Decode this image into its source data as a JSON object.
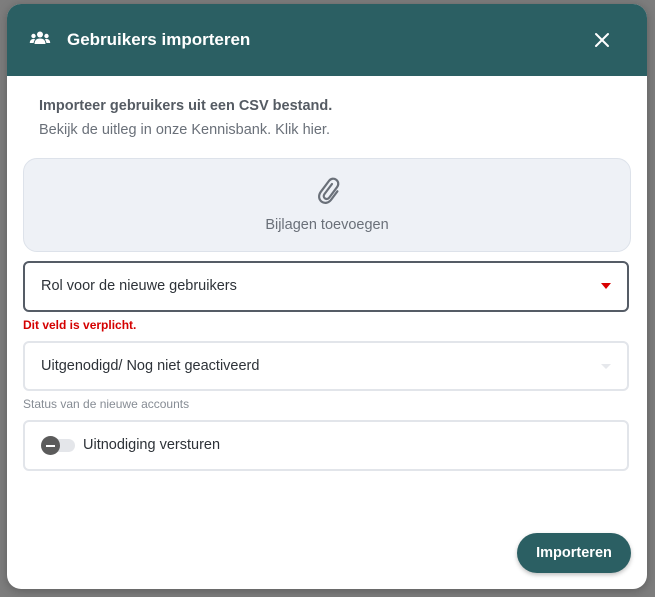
{
  "modal": {
    "title": "Gebruikers importeren",
    "header_icon": "users-icon",
    "close_icon": "close-icon"
  },
  "intro": {
    "title": "Importeer gebruikers uit een CSV bestand.",
    "text": "Bekijk de uitleg in onze Kennisbank. Klik hier."
  },
  "dropzone": {
    "icon": "paperclip-icon",
    "label": "Bijlagen toevoegen"
  },
  "role_select": {
    "placeholder": "Rol voor de nieuwe gebruikers",
    "error": "Dit veld is verplicht.",
    "caret_color": "#d90000"
  },
  "status_select": {
    "value": "Uitgenodigd/ Nog niet geactiveerd",
    "helper": "Status van de nieuwe accounts"
  },
  "invite_toggle": {
    "label": "Uitnodiging versturen",
    "checked": false
  },
  "actions": {
    "import_label": "Importeren"
  },
  "colors": {
    "brand": "#2b5f63",
    "error": "#d40000"
  }
}
